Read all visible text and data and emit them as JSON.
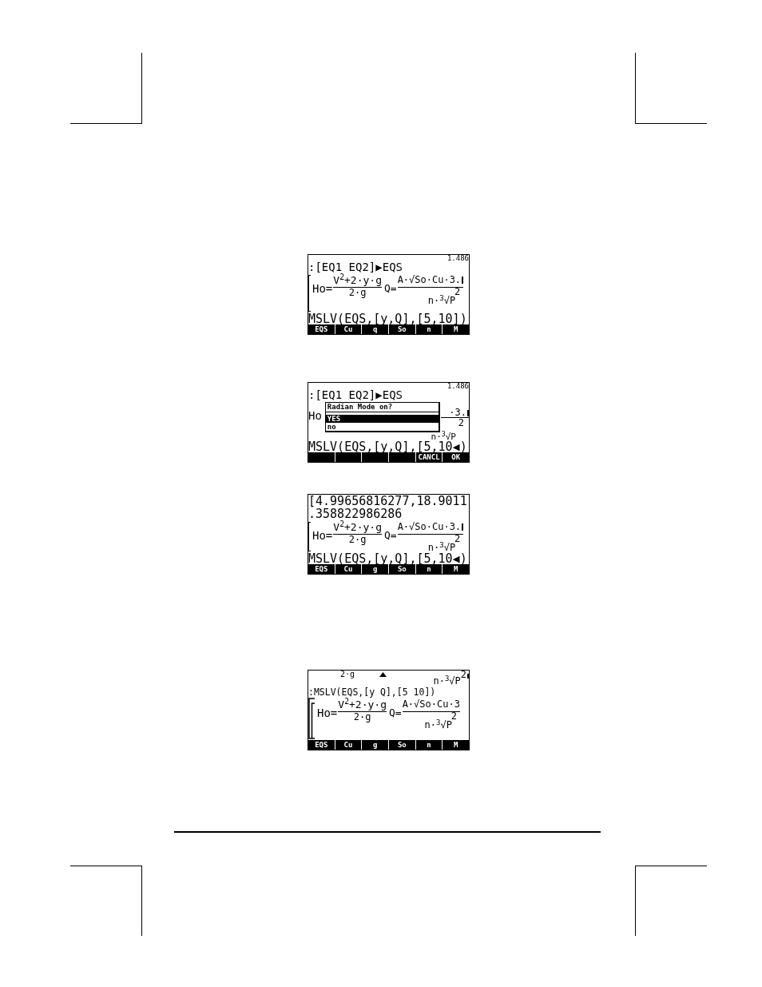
{
  "screens": [
    {
      "kind": "equations",
      "status": "1.486",
      "history": [
        ":[EQ1 EQ2]▶EQS"
      ],
      "equation": {
        "ho_label": "Ho=",
        "ho_numerator": "V$^{2}$+2·y·g",
        "ho_denominator": "2·g",
        "q_label": "Q=",
        "q_numerator": "A·√So·Cu·3.",
        "q_denominator_exponent": "2",
        "q_denominator": "n·$^{3}$√P"
      },
      "command": "MSLV(EQS,[y,Q],[5,10])",
      "softkeys": [
        {
          "kind": "label",
          "label": "EQS"
        },
        {
          "kind": "label",
          "label": "Cu"
        },
        {
          "kind": "label",
          "label": "q"
        },
        {
          "kind": "label",
          "label": "So"
        },
        {
          "kind": "label",
          "label": "n"
        },
        {
          "kind": "label",
          "label": "M"
        }
      ]
    },
    {
      "kind": "dialog",
      "status": "1.486",
      "history": [
        ":[EQ1 EQ2]▶EQS"
      ],
      "behind": {
        "left": "Ho",
        "right_numerator": "·3.",
        "right_denominator": "2",
        "bottom": "n·$^{3}$√P"
      },
      "dialog": {
        "title": "Radian Mode on?",
        "options": [
          {
            "label": "YES",
            "selected": true
          },
          {
            "label": "no",
            "selected": false
          }
        ]
      },
      "command": "MSLV(EQS,[y,Q],[5,10◀)",
      "softkeys": [
        {
          "kind": "blank"
        },
        {
          "kind": "blank"
        },
        {
          "kind": "blank"
        },
        {
          "kind": "blank"
        },
        {
          "kind": "label",
          "label": "CANCL"
        },
        {
          "kind": "label",
          "label": "OK"
        }
      ]
    },
    {
      "kind": "equations",
      "history": [
        "[4.99656816277,18.9011",
        ".358822986286"
      ],
      "equation": {
        "ho_label": "Ho=",
        "ho_numerator": "V$^{2}$+2·y·g",
        "ho_denominator": "2·g",
        "q_label": "Q=",
        "q_numerator": "A·√So·Cu·3.",
        "q_denominator_exponent": "2",
        "q_denominator": "n·$^{3}$√P"
      },
      "command": "MSLV(EQS,[y,Q],[5,10◀)",
      "softkeys": [
        {
          "kind": "label",
          "label": "EQS"
        },
        {
          "kind": "label",
          "label": "Cu"
        },
        {
          "kind": "label",
          "label": "g"
        },
        {
          "kind": "label",
          "label": "So"
        },
        {
          "kind": "label",
          "label": "n"
        },
        {
          "kind": "label",
          "label": "M"
        }
      ]
    },
    {
      "kind": "result",
      "overflow": {
        "left": "2·g",
        "right": "n·$^{3}$√P",
        "right_exponent": "2"
      },
      "history": [
        ":MSLV(EQS,[y Q],[5 10])"
      ],
      "equation": {
        "ho_label": "Ho=",
        "ho_numerator": "V$^{2}$+2·y·g",
        "ho_denominator": "2·g",
        "q_label": "Q=",
        "q_numerator": "A·√So·Cu·3",
        "q_denominator_exponent": "2",
        "q_denominator": "n·$^{3}$√P"
      },
      "softkeys": [
        {
          "kind": "label",
          "label": "EQS"
        },
        {
          "kind": "label",
          "label": "Cu"
        },
        {
          "kind": "label",
          "label": "g"
        },
        {
          "kind": "label",
          "label": "So"
        },
        {
          "kind": "label",
          "label": "n"
        },
        {
          "kind": "label",
          "label": "M"
        }
      ]
    }
  ]
}
